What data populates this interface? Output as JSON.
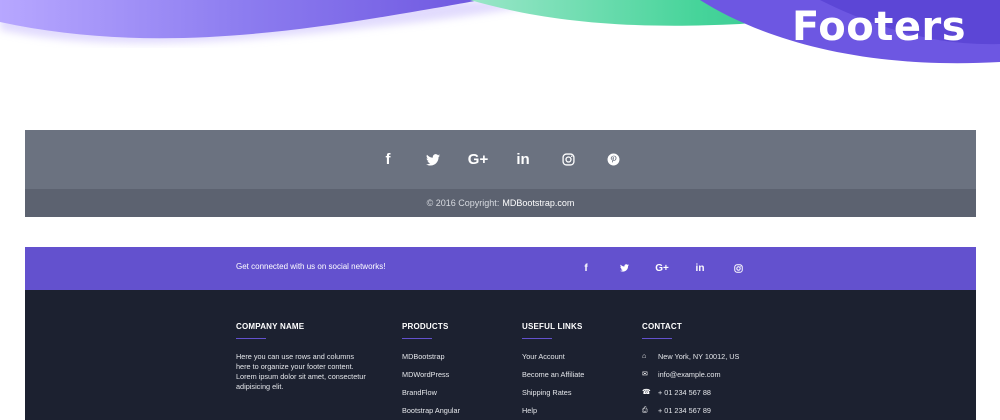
{
  "hero": {
    "title": "Footers"
  },
  "footer1": {
    "social": [
      {
        "glyph": "f",
        "icon": "facebook-icon"
      },
      {
        "glyph": "🐦",
        "icon": "twitter-icon"
      },
      {
        "glyph": "G+",
        "icon": "google-plus-icon"
      },
      {
        "glyph": "in",
        "icon": "linkedin-icon"
      },
      {
        "glyph": "◎",
        "icon": "instagram-icon"
      },
      {
        "glyph": "℗",
        "icon": "pinterest-icon"
      }
    ],
    "copyright": "© 2016 Copyright:",
    "copyright_link": "MDBootstrap.com"
  },
  "footer2": {
    "bar_text": "Get connected with us on social networks!",
    "social": [
      {
        "glyph": "f",
        "icon": "facebook-icon"
      },
      {
        "glyph": "🐦",
        "icon": "twitter-icon"
      },
      {
        "glyph": "G+",
        "icon": "google-plus-icon"
      },
      {
        "glyph": "in",
        "icon": "linkedin-icon"
      },
      {
        "glyph": "◎",
        "icon": "instagram-icon"
      }
    ],
    "company": {
      "title": "COMPANY NAME",
      "text": "Here you can use rows and columns here to organize your footer content. Lorem ipsum dolor sit amet, consectetur adipisicing elit."
    },
    "products": {
      "title": "PRODUCTS",
      "links": [
        "MDBootstrap",
        "MDWordPress",
        "BrandFlow",
        "Bootstrap Angular"
      ]
    },
    "useful": {
      "title": "USEFUL LINKS",
      "links": [
        "Your Account",
        "Become an Affiliate",
        "Shipping Rates",
        "Help"
      ]
    },
    "contact": {
      "title": "CONTACT",
      "rows": [
        {
          "icon": "home-icon",
          "glyph": "⌂",
          "text": "New York, NY 10012, US"
        },
        {
          "icon": "envelope-icon",
          "glyph": "✉",
          "text": "info@example.com"
        },
        {
          "icon": "phone-icon",
          "glyph": "☎",
          "text": "+ 01 234 567 88"
        },
        {
          "icon": "print-icon",
          "glyph": "⎙",
          "text": "+ 01 234 567 89"
        }
      ]
    }
  },
  "colors": {
    "accent": "#6351ce",
    "dark": "#1c2130",
    "grey": "#6b7280"
  }
}
